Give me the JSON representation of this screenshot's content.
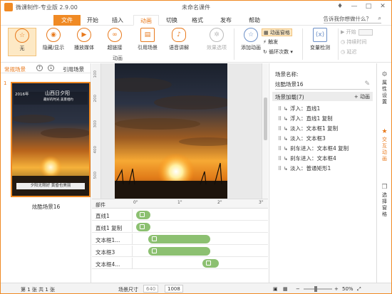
{
  "app": {
    "title": "微课制作-专业版 2.9.00",
    "document_title": "未命名课件"
  },
  "tabs": [
    "文件",
    "开始",
    "插入",
    "动画",
    "切换",
    "格式",
    "发布",
    "帮助"
  ],
  "active_tab": "动画",
  "tellme": "告诉我你想做什么？",
  "ribbon": {
    "effects": [
      {
        "label": "无",
        "icon": "star-outline-icon"
      },
      {
        "label": "隐藏/显示",
        "icon": "eye-icon"
      },
      {
        "label": "播放媒体",
        "icon": "play-icon"
      },
      {
        "label": "超链接",
        "icon": "link-icon"
      },
      {
        "label": "引用场景",
        "icon": "clapper-icon"
      },
      {
        "label": "语音讲解",
        "icon": "microphone-icon"
      }
    ],
    "effect_options": "效果选项",
    "add_animation": "添加动画",
    "group_animation": "动画",
    "animation_pane": "动画窗格",
    "trigger": "触发",
    "repeat": "循环次数",
    "variable_check": "变量检测",
    "start": "开始",
    "duration": "持续时间",
    "delay": "延迟"
  },
  "left_panel": {
    "tab_normal": "常规场景",
    "tab_reference": "引用场景",
    "scene_number": "1",
    "scene_label": "炫酷场景16",
    "thumb_date_text": "2016年",
    "thumb_title": "山西日夕阳",
    "thumb_sub": "最好的时光 美景相约",
    "thumb_caption": "夕阳无限好 黄昏也美丽"
  },
  "timeline": {
    "header": "部件",
    "ticks": [
      "0\"",
      "1\"",
      "2\"",
      "3\""
    ],
    "rows": [
      {
        "name": "直线1",
        "start": 0.0,
        "end": 0.3
      },
      {
        "name": "直线1 复制",
        "start": 0.0,
        "end": 0.3
      },
      {
        "name": "文本框1...",
        "start": 0.3,
        "end": 1.8
      },
      {
        "name": "文本框3",
        "start": 0.3,
        "end": 1.8
      },
      {
        "name": "文本框4...",
        "start": 1.6,
        "end": 2.0
      }
    ]
  },
  "right_panel": {
    "title": "场景名称:",
    "scene_name": "炫酷场景16",
    "section": "场景加载(7)",
    "add_animation": "+ 动画",
    "events": [
      "浮入：直线1",
      "浮入：直线1 复制",
      "淡入：文本框1 复制",
      "淡入：文本框3",
      "刹车进入：文本框4 复制",
      "刹车进入：文本框4",
      "淡入：普通矩形1"
    ]
  },
  "side_tabs": [
    {
      "label": "属性设置",
      "icon": "gear-icon"
    },
    {
      "label": "交互动画",
      "icon": "star-icon"
    },
    {
      "label": "选择窗格",
      "icon": "layers-icon"
    }
  ],
  "status": {
    "page": "第 1 张  共 1 张",
    "size_label": "场景尺寸",
    "width": "640",
    "height": "1008",
    "zoom": "50%"
  },
  "colors": {
    "accent": "#f08a24",
    "bar": "#8cc071"
  }
}
